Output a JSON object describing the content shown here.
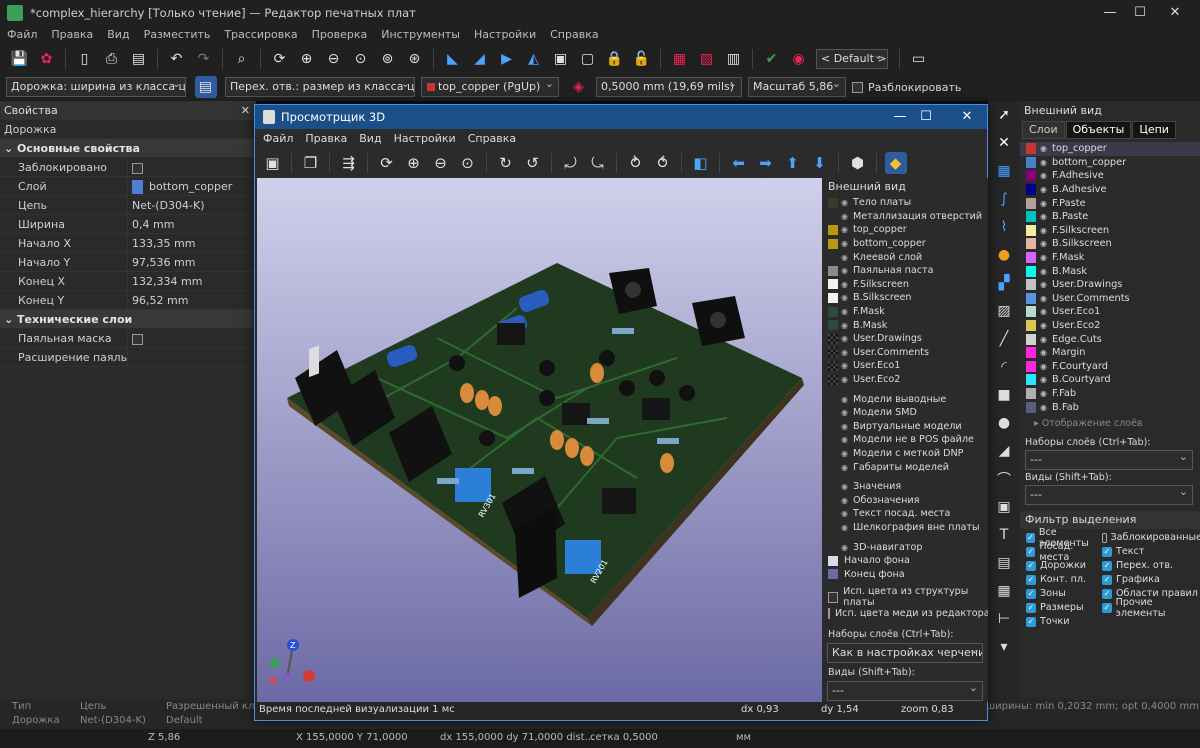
{
  "window": {
    "title": "*complex_hierarchy [Только чтение] — Редактор печатных плат"
  },
  "menu": [
    "Файл",
    "Правка",
    "Вид",
    "Разместить",
    "Трассировка",
    "Проверка",
    "Инструменты",
    "Настройки",
    "Справка"
  ],
  "toolbar1": {
    "icons": [
      "save-icon",
      "board-setup-icon",
      "page-icon",
      "print-icon",
      "plot-icon",
      "undo-icon",
      "redo-icon",
      "find-icon",
      "refresh-icon",
      "zoom-in-icon",
      "zoom-out-icon",
      "zoom-fit-icon",
      "zoom-selection-icon",
      "zoom-object-icon",
      "rotate-ccw-icon",
      "rotate-cw-icon",
      "flip-icon",
      "mirror-icon",
      "group-icon",
      "ungroup-icon",
      "lock-icon",
      "unlock-icon",
      "netlist-icon",
      "schematic-icon",
      "footprint-icon",
      "drc-icon",
      "layer-icon",
      "scripting-icon"
    ],
    "preset": "< Default >"
  },
  "toolbar2": {
    "track_width": "Дорожка: ширина из класса цепей",
    "via_size": "Перех. отв.: размер из класса цепей",
    "layer": "top_copper (PgUp)",
    "grid": "0,5000 mm (19,69 mils)",
    "zoom": "Масштаб 5,86",
    "unlock": "Разблокировать"
  },
  "properties": {
    "title": "Свойства",
    "type": "Дорожка",
    "section_main": "Основные свойства",
    "rows": [
      {
        "k": "Заблокировано",
        "v": ""
      },
      {
        "k": "Слой",
        "v": "bottom_copper"
      },
      {
        "k": "Цепь",
        "v": "Net-(D304-K)"
      },
      {
        "k": "Ширина",
        "v": "0,4 mm"
      },
      {
        "k": "Начало X",
        "v": "133,35 mm"
      },
      {
        "k": "Начало Y",
        "v": "97,536 mm"
      },
      {
        "k": "Конец X",
        "v": "132,334 mm"
      },
      {
        "k": "Конец Y",
        "v": "96,52 mm"
      }
    ],
    "section_tech": "Технические слои",
    "rows2": [
      {
        "k": "Паяльная маска",
        "v": ""
      },
      {
        "k": "Расширение паяльной маски",
        "v": ""
      }
    ]
  },
  "appearance": {
    "title": "Внешний вид",
    "tabs": [
      "Слои",
      "Объекты",
      "Цепи"
    ],
    "layers": [
      {
        "name": "top_copper",
        "color": "#c83434"
      },
      {
        "name": "bottom_copper",
        "color": "#4d7fc4"
      },
      {
        "name": "F.Adhesive",
        "color": "#84007c"
      },
      {
        "name": "B.Adhesive",
        "color": "#00008a"
      },
      {
        "name": "F.Paste",
        "color": "#b4a09a"
      },
      {
        "name": "B.Paste",
        "color": "#00c2c2"
      },
      {
        "name": "F.Silkscreen",
        "color": "#f2eda1"
      },
      {
        "name": "B.Silkscreen",
        "color": "#e8b2a7"
      },
      {
        "name": "F.Mask",
        "color": "#d864ff"
      },
      {
        "name": "B.Mask",
        "color": "#02ffee"
      },
      {
        "name": "User.Drawings",
        "color": "#c2c2c2"
      },
      {
        "name": "User.Comments",
        "color": "#5994dc"
      },
      {
        "name": "User.Eco1",
        "color": "#b4dbd2"
      },
      {
        "name": "User.Eco2",
        "color": "#d8c852"
      },
      {
        "name": "Edge.Cuts",
        "color": "#d0d2cd"
      },
      {
        "name": "Margin",
        "color": "#ff26e2"
      },
      {
        "name": "F.Courtyard",
        "color": "#ff26e2"
      },
      {
        "name": "B.Courtyard",
        "color": "#26e9ff"
      },
      {
        "name": "F.Fab",
        "color": "#afafaf"
      },
      {
        "name": "B.Fab",
        "color": "#585d84"
      }
    ],
    "layer_display": "Отображение слоёв",
    "presets_label": "Наборы слоёв (Ctrl+Tab):",
    "presets_value": "---",
    "views_label": "Виды (Shift+Tab):",
    "views_value": "---",
    "filter_title": "Фильтр выделения",
    "filters": [
      {
        "l": "Все элементы",
        "on": true
      },
      {
        "l": "Заблокированные",
        "on": false
      },
      {
        "l": "Посад. места",
        "on": true
      },
      {
        "l": "Текст",
        "on": true
      },
      {
        "l": "Дорожки",
        "on": true
      },
      {
        "l": "Перех. отв.",
        "on": true
      },
      {
        "l": "Конт. пл.",
        "on": true
      },
      {
        "l": "Графика",
        "on": true
      },
      {
        "l": "Зоны",
        "on": true
      },
      {
        "l": "Области правил",
        "on": true
      },
      {
        "l": "Размеры",
        "on": true
      },
      {
        "l": "Прочие элементы",
        "on": true
      },
      {
        "l": "Точки",
        "on": true
      }
    ]
  },
  "messages": {
    "c1": "Тип",
    "c2": "Цепь",
    "c3": "Разрешенный класс",
    "v1": "Дорожка",
    "v2": "Net-(D304-K)",
    "v3": "Default",
    "r": "ширины: min 0,2032 mm; opt 0,4000 mm"
  },
  "status": {
    "z": "Z 5,86",
    "xy": "X 155,0000  Y 71,0000",
    "d": "dx 155,0000  dy 71,0000  dist...",
    "grid": "сетка 0,5000",
    "unit": "мм"
  },
  "viewer": {
    "title": "Просмотрщик 3D",
    "menu": [
      "Файл",
      "Правка",
      "Вид",
      "Настройки",
      "Справка"
    ],
    "panel_title": "Внешний вид",
    "items1": [
      {
        "name": "Тело платы",
        "color": "#3b3a2a"
      },
      {
        "name": "Металлизация отверстий",
        "color": ""
      },
      {
        "name": "top_copper",
        "color": "#b89a10"
      },
      {
        "name": "bottom_copper",
        "color": "#b89a10"
      },
      {
        "name": "Клеевой слой",
        "color": ""
      },
      {
        "name": "Паяльная паста",
        "color": "#8c8c8c"
      },
      {
        "name": "F.Silkscreen",
        "color": "#f2f2f2"
      },
      {
        "name": "B.Silkscreen",
        "color": "#f2f2f2"
      },
      {
        "name": "F.Mask",
        "color": "#2e4a3e"
      },
      {
        "name": "B.Mask",
        "color": "#2e4a3e"
      },
      {
        "name": "User.Drawings",
        "color": "check"
      },
      {
        "name": "User.Comments",
        "color": "check"
      },
      {
        "name": "User.Eco1",
        "color": "check"
      },
      {
        "name": "User.Eco2",
        "color": "check"
      }
    ],
    "items2": [
      "Модели выводные",
      "Модели SMD",
      "Виртуальные модели",
      "Модели не в POS файле",
      "Модели с меткой DNP",
      "Габариты моделей"
    ],
    "items3": [
      "Значения",
      "Обозначения",
      "Текст посад. места",
      "Шелкография вне платы"
    ],
    "items4": [
      {
        "name": "3D-навигатор",
        "color": ""
      },
      {
        "name": "Начало фона",
        "color": "#d8d8ee"
      },
      {
        "name": "Конец фона",
        "color": "#6c6aa4"
      }
    ],
    "opt1": "Исп. цвета из структуры платы",
    "opt2": "Исп. цвета меди из редактора плат",
    "presets_label": "Наборы слоёв (Ctrl+Tab):",
    "presets_value": "Как в настройках черчения",
    "views_label": "Виды (Shift+Tab):",
    "views_value": "---",
    "status_msg": "Время последней визуализации 1 мс",
    "dx": "dx 0,93",
    "dy": "dy 1,54",
    "zoom": "zoom 0,83",
    "labels": [
      "RV301",
      "RV201"
    ]
  }
}
